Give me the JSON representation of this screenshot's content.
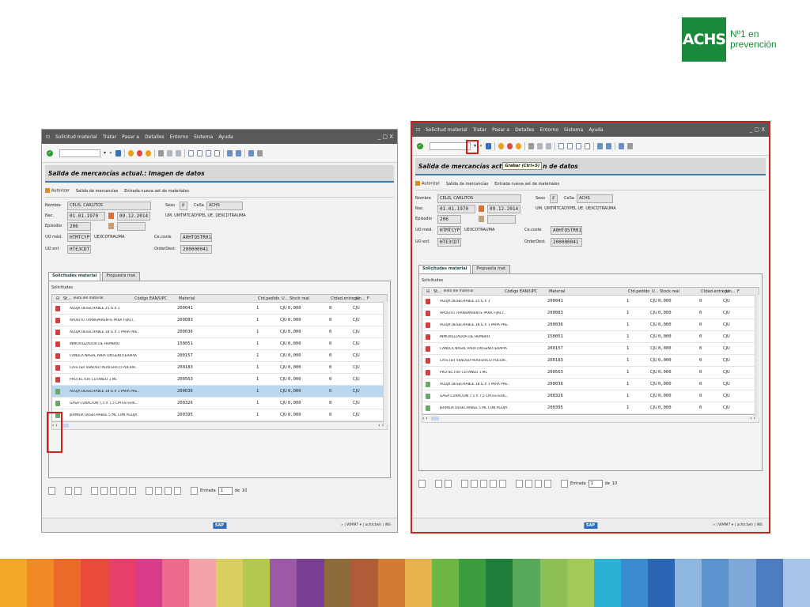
{
  "logo": {
    "brand": "ACHS",
    "tagline_1": "Nº1 en",
    "tagline_2": "prevención"
  },
  "colors": {
    "brand_green": "#1a8a3a",
    "highlight_red": "#d02020",
    "sap_blue_rule": "#3c7ab0",
    "selected_row": "#b9d7ef"
  },
  "stripe_colors": [
    "#f3a726",
    "#f08a24",
    "#eb6a2a",
    "#e84b3c",
    "#e83e6a",
    "#d93d8a",
    "#ec6b8b",
    "#f4a3a8",
    "#d9cf60",
    "#b3c84d",
    "#9b59a8",
    "#7a3f93",
    "#8c6b3d",
    "#b05c36",
    "#d47a35",
    "#e6b24a",
    "#6fb744",
    "#3c9d3f",
    "#1e7e3a",
    "#58a85a",
    "#8cc057",
    "#a3c956",
    "#2bb0d6",
    "#3a8ccf",
    "#2a66b3",
    "#8db7df",
    "#5b93cf",
    "#7fa8d8",
    "#4d7dc0",
    "#a6c5e6"
  ],
  "sap": {
    "menu": [
      "Solicitud material",
      "Tratar",
      "Pasar a",
      "Detalles",
      "Entorno",
      "Sistema",
      "Ayuda"
    ],
    "window_controls": "_ ▢ X",
    "dropdown_arrow": "▾",
    "page_title": "Salida de mercancías actual.: Imagen de datos",
    "right_title_part1": "Salida de mercancías act",
    "right_title_part2": "n de datos",
    "tooltip": "Grabar  (Ctrl+S)",
    "app_actions": [
      "Autorizar",
      "Salida de mercancías",
      "Entrada nueva set de materiales"
    ],
    "form": {
      "nombre_label": "Nombre",
      "nombre": "CELIS, CARLITOS",
      "nac_label": "Nac.",
      "nac": "01.01.1970",
      "fecha": "09.12.2014",
      "episodio_label": "Episodio",
      "episodio": "206",
      "uo_med_label": "UO méd.",
      "uo_med": "HTMTCYP",
      "uo_med_text": "UEXCDTRAUMA",
      "uo_enf_label": "UO enf.",
      "uo_enf": "HTE3CDT",
      "sexo_label": "Sexo",
      "sexo": "F",
      "cesa_label": "CeSa",
      "cesa": "ACHS",
      "unidades_text": "UM. UMTMTCADYPEL  UE. UEXCDTRAUMA",
      "cecoste_label": "Ce.coste",
      "cecoste": "A0HTOSTR01",
      "orderdest_label": "OrderDest.",
      "orderdest": "200000041"
    },
    "tabs": [
      "Solicitudes material",
      "Propuesta mat."
    ],
    "panel_title": "Solicitudes",
    "columns": [
      "St...",
      "Texto del material",
      "Código EAN/UPC",
      "Material",
      "Ctd.pedido",
      "U...",
      "Stock real",
      "Ctdad.entrega",
      "Un...",
      "F"
    ],
    "rows": [
      {
        "texto": "AGUJA DESECHABLE 25 G X 1",
        "material": "200041",
        "qty": "1",
        "un": "CJU",
        "stock": "0,000",
        "entrega": "0",
        "un2": "CJU"
      },
      {
        "texto": "APOSITO TRANSPARENTE PARA FIJACI..",
        "material": "200083",
        "qty": "1",
        "un": "CJU",
        "stock": "0,000",
        "entrega": "0",
        "un2": "CJU"
      },
      {
        "texto": "AGUJA DESECHABLE 18 G X 1 PARA PRE..",
        "material": "200036",
        "qty": "1",
        "un": "CJU",
        "stock": "0,000",
        "entrega": "0",
        "un2": "CJU"
      },
      {
        "texto": "INMOVILIZADOR DE HOMBRO",
        "material": "150051",
        "qty": "1",
        "un": "CJU",
        "stock": "0,000",
        "entrega": "0",
        "un2": "CJU"
      },
      {
        "texto": "CANULA NASAL PARA OXIGENOTERAPIA",
        "material": "200157",
        "qty": "1",
        "un": "CJU",
        "stock": "0,000",
        "entrega": "0",
        "un2": "CJU"
      },
      {
        "texto": "CATETER VENOSO PERIFERICO POLIUR..",
        "material": "200183",
        "qty": "1",
        "un": "CJU",
        "stock": "0,000",
        "entrega": "0",
        "un2": "CJU"
      },
      {
        "texto": "PROTECTOR CUTANEO 1 ML",
        "material": "200563",
        "qty": "1",
        "un": "CJU",
        "stock": "0,000",
        "entrega": "0",
        "un2": "CJU"
      },
      {
        "texto": "AGUJA DESECHABLE 18 G X 1 PARA PRE..",
        "material": "200036",
        "qty": "1",
        "un": "CJU",
        "stock": "0,000",
        "entrega": "0",
        "un2": "CJU"
      },
      {
        "texto": "GASA CURACION 7,5 X 7,5 CM ESTERIL..",
        "material": "200326",
        "qty": "1",
        "un": "CJU",
        "stock": "0,000",
        "entrega": "0",
        "un2": "CJU"
      },
      {
        "texto": "JERINGA DESECHABLE 5 ML CON AGUJA..",
        "material": "200395",
        "qty": "1",
        "un": "CJU",
        "stock": "0,000",
        "entrega": "0",
        "un2": "CJU"
      }
    ],
    "hscroll_left": "‹ ›",
    "hscroll_right": "‹ ›",
    "entrada_label": "Entrada",
    "entrada_value": "1",
    "de_label": "de",
    "total": "10",
    "sap_logo": "SAP",
    "status": "» | WMM7 ▾ | achtctwh | INS"
  }
}
